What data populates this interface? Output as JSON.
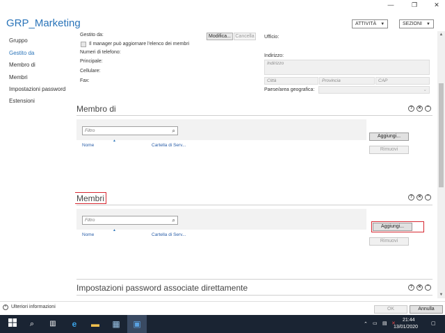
{
  "window": {
    "restore_glyph": "❐",
    "close_glyph": "✕"
  },
  "title": "GRP_Marketing",
  "header": {
    "activities_label": "ATTIVITÀ",
    "sections_label": "SEZIONI"
  },
  "sidebar": {
    "items": [
      {
        "label": "Gruppo",
        "active": false
      },
      {
        "label": "Gestito da",
        "active": true
      },
      {
        "label": "Membro di",
        "active": false
      },
      {
        "label": "Membri",
        "active": false
      },
      {
        "label": "Impostazioni password",
        "active": false
      },
      {
        "label": "Estensioni",
        "active": false
      }
    ]
  },
  "managed_by": {
    "label": "Gestito da:",
    "modify_button": "Modifica...",
    "cancel_button": "Cancella",
    "checkbox_label": "Il manager può aggiornare l'elenco dei membri",
    "phones_label": "Numeri di telefono:",
    "main_label": "Principale:",
    "mobile_label": "Cellulare:",
    "fax_label": "Fax:",
    "office_label": "Ufficio:",
    "address_label": "Indirizzo:",
    "address_placeholder": "Indirizzo",
    "city_placeholder": "Città",
    "province_placeholder": "Provincia",
    "zip_placeholder": "CAP",
    "country_label": "Paese/area geografica:"
  },
  "member_of": {
    "title": "Membro di",
    "filter_placeholder": "Filtro",
    "col_name": "Nome",
    "col_folder": "Cartella di Serv...",
    "add_button": "Aggiungi...",
    "remove_button": "Rimuovi"
  },
  "members": {
    "title": "Membri",
    "filter_placeholder": "Filtro",
    "col_name": "Nome",
    "col_folder": "Cartella di Serv...",
    "add_button": "Aggiungi...",
    "remove_button": "Rimuovi"
  },
  "password_settings": {
    "title": "Impostazioni password associate direttamente"
  },
  "section_icons": {
    "help": "?",
    "close": "✕",
    "collapse": "⌃"
  },
  "footer": {
    "more_info": "Ulteriori informazioni",
    "ok_button": "OK",
    "cancel_button": "Annulla"
  },
  "taskbar": {
    "time": "21:44",
    "date": "13/01/2020"
  }
}
